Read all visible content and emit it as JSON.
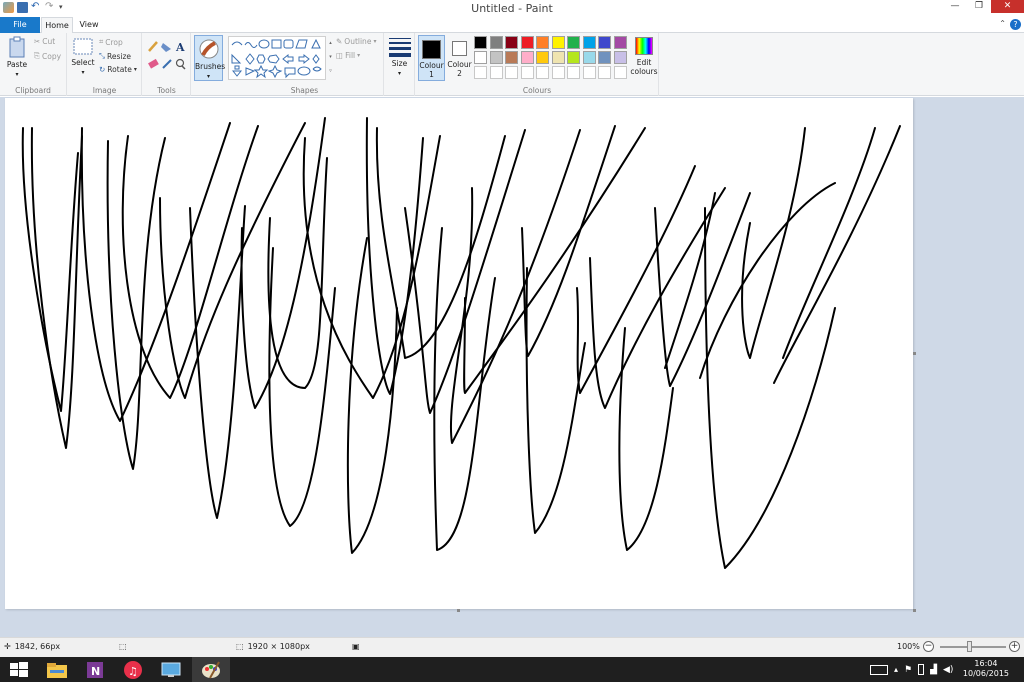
{
  "window": {
    "title": "Untitled - Paint",
    "controls": [
      "minimize-icon",
      "restore-icon",
      "close-icon"
    ]
  },
  "tabs": [
    {
      "label": "File",
      "active": false
    },
    {
      "label": "Home",
      "active": true
    },
    {
      "label": "View",
      "active": false
    }
  ],
  "ribbon": {
    "clipboard": {
      "label": "Clipboard",
      "paste": "Paste",
      "cut": "Cut",
      "copy": "Copy"
    },
    "image": {
      "label": "Image",
      "select": "Select",
      "crop": "Crop",
      "resize": "Resize",
      "rotate": "Rotate"
    },
    "tools": {
      "label": "Tools"
    },
    "brushes": {
      "label": "Brushes"
    },
    "shapes": {
      "label": "Shapes",
      "outline": "Outline",
      "fill": "Fill"
    },
    "size": {
      "label": "Size"
    },
    "colours": {
      "label": "Colours",
      "colour1": "Colour",
      "colour1_num": "1",
      "colour2": "Colour",
      "colour2_num": "2",
      "edit": "Edit",
      "edit2": "colours",
      "colour1_value": "#000000",
      "colour2_value": "#ffffff",
      "palette_row1": [
        "#000000",
        "#7f7f7f",
        "#880015",
        "#ed1c24",
        "#ff7f27",
        "#fff200",
        "#22b14c",
        "#00a2e8",
        "#3f48cc",
        "#a349a4"
      ],
      "palette_row2": [
        "#ffffff",
        "#c3c3c3",
        "#b97a57",
        "#ffaec9",
        "#ffc90e",
        "#efe4b0",
        "#b5e61d",
        "#99d9ea",
        "#7092be",
        "#c8bfe7"
      ]
    }
  },
  "status": {
    "cursor_pos": "1842, 66px",
    "image_size": "1920 × 1080px",
    "zoom": "100%",
    "zoom_level": 0.5
  },
  "taskbar": {
    "apps": [
      "windows-start-icon",
      "file-explorer-icon",
      "onenote-icon",
      "itunes-icon",
      "remote-desktop-icon",
      "paint-icon"
    ],
    "time": "16:04",
    "date": "10/06/2015"
  }
}
